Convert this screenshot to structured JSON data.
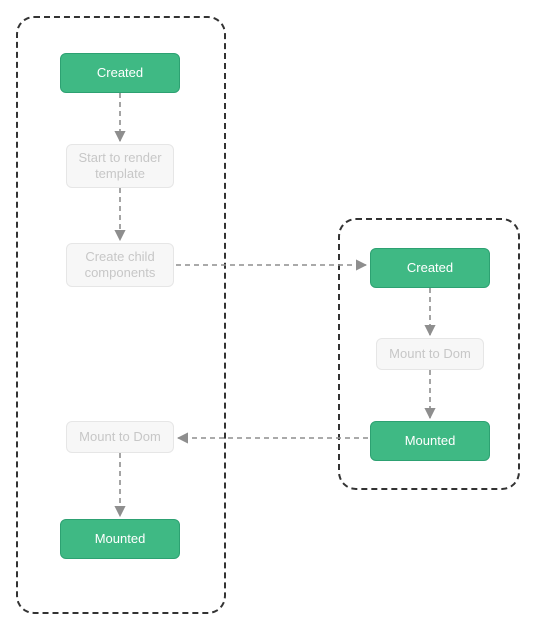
{
  "colors": {
    "state_bg": "#3fb984",
    "state_text": "#ffffff",
    "step_bg": "#f7f7f7",
    "step_text": "#c7c7c7",
    "group_border": "#333333",
    "edge": "#8e8e8e"
  },
  "left_group": {
    "created": "Created",
    "render_step": "Start to render template",
    "create_children_step": "Create child components",
    "mount_step": "Mount to Dom",
    "mounted": "Mounted"
  },
  "right_group": {
    "created": "Created",
    "mount_step": "Mount to Dom",
    "mounted": "Mounted"
  }
}
